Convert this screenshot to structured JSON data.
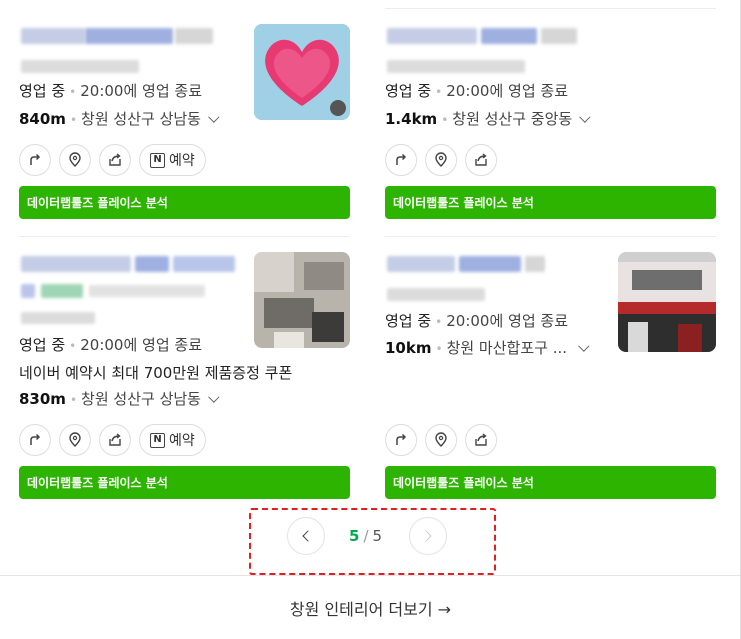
{
  "cards": [
    {
      "status": "영업 중",
      "hours": "20:00에 영업 종료",
      "distance": "840m",
      "address": "창원 성산구 상남동",
      "booking_label": "예약",
      "analysis_label": "데이터랩툴즈 플레이스 분석"
    },
    {
      "status": "영업 중",
      "hours": "20:00에 영업 종료",
      "distance": "1.4km",
      "address": "창원 성산구 중앙동",
      "analysis_label": "데이터랩툴즈 플레이스 분석"
    },
    {
      "status": "영업 중",
      "hours": "20:00에 영업 종료",
      "promo": "네이버 예약시 최대 700만원 제품증정 쿠폰",
      "distance": "830m",
      "address": "창원 성산구 상남동",
      "booking_label": "예약",
      "analysis_label": "데이터랩툴즈 플레이스 분석"
    },
    {
      "status": "영업 중",
      "hours": "20:00에 영업 종료",
      "distance": "10km",
      "address": "창원 마산합포구 ...",
      "analysis_label": "데이터랩툴즈 플레이스 분석"
    }
  ],
  "pagination": {
    "current": "5",
    "separator": "/",
    "total": "5"
  },
  "more_link": "창원 인테리어 더보기 →",
  "colors": {
    "brand_green": "#2db400",
    "page_green": "#03a94d",
    "highlight_red": "#e02020"
  }
}
